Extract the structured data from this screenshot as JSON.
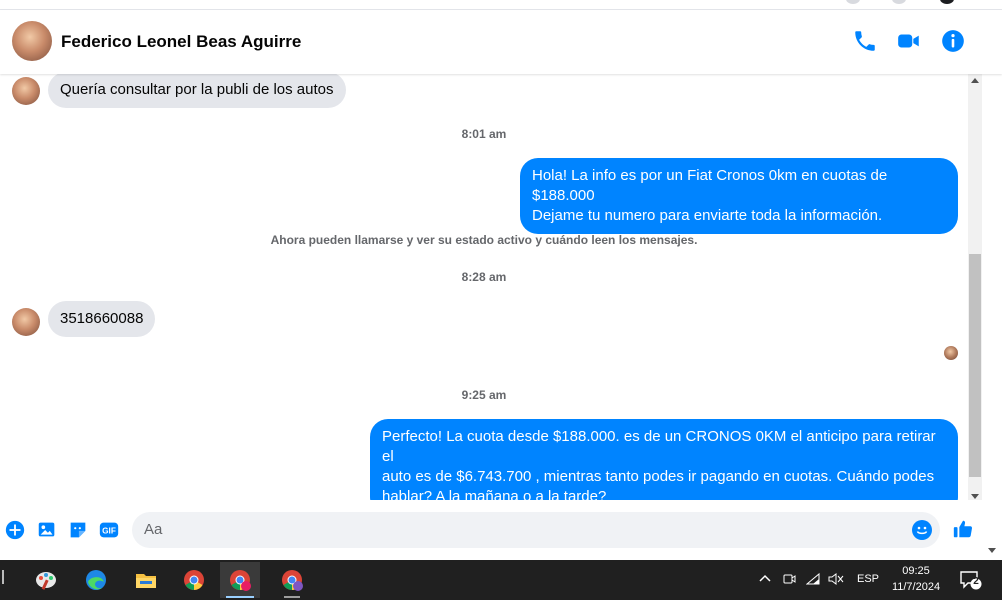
{
  "header": {
    "contact_name": "Federico Leonel Beas Aguirre",
    "icons": [
      "phone-icon",
      "video-camera-icon",
      "info-icon"
    ]
  },
  "messages": [
    {
      "side": "in",
      "text": "Quería consultar por la publi de los autos"
    },
    {
      "timestamp": "8:01 am"
    },
    {
      "side": "out",
      "line1": "Hola! La info es por un Fiat Cronos 0km en cuotas de $188.000",
      "line2": "Dejame tu numero  para enviarte toda la información."
    },
    {
      "system": "Ahora pueden llamarse y ver su estado activo y cuándo leen los mensajes."
    },
    {
      "timestamp": "8:28 am"
    },
    {
      "side": "in",
      "text": "3518660088"
    },
    {
      "timestamp": "9:25 am"
    },
    {
      "side": "out",
      "line1": "Perfecto! La cuota desde $188.000. es de un CRONOS 0KM el anticipo para retirar el",
      "line2": "auto es de $6.743.700 , mientras tanto podes ir pagando en cuotas. Cuándo podes",
      "line3": "hablar? A la mañana o a la tarde?"
    }
  ],
  "composer": {
    "placeholder": "Aa",
    "icons": [
      "add-icon",
      "photo-icon",
      "sticker-icon",
      "gif-icon",
      "emoji-icon",
      "like-icon"
    ],
    "gif_label": "GIF"
  },
  "taskbar": {
    "apps": [
      "paint-icon",
      "edge-icon",
      "file-explorer-icon",
      "chrome-icon",
      "chrome-profile-icon",
      "chrome-profile-2-icon"
    ],
    "language": "ESP",
    "time": "09:25",
    "date": "11/7/2024",
    "notification_count": "2"
  },
  "colors": {
    "accent": "#0084ff",
    "incoming_bubble": "#e4e6eb",
    "taskbar": "#202020"
  }
}
